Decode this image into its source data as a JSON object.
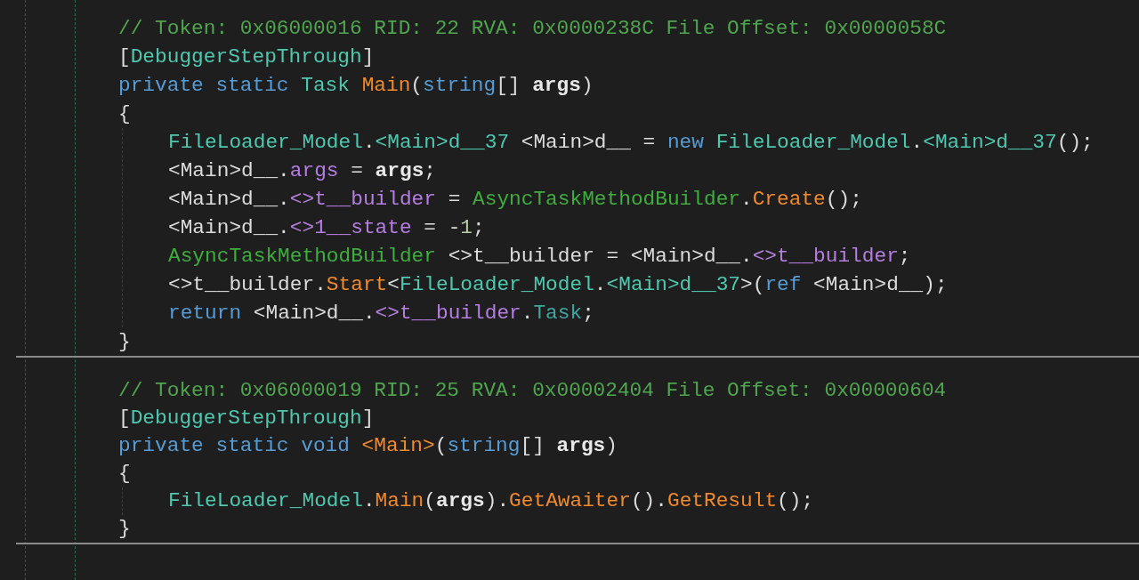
{
  "blocks": [
    {
      "lines": [
        {
          "tokens": [
            {
              "text": "// Token: 0x06000016 RID: 22 RVA: 0x0000238C File Offset: 0x0000058C",
              "kind": "comment"
            }
          ]
        },
        {
          "tokens": [
            {
              "text": "[",
              "kind": "plain"
            },
            {
              "text": "DebuggerStepThrough",
              "kind": "class"
            },
            {
              "text": "]",
              "kind": "plain"
            }
          ]
        },
        {
          "tokens": [
            {
              "text": "private static ",
              "kind": "keyword"
            },
            {
              "text": "Task ",
              "kind": "class"
            },
            {
              "text": "Main",
              "kind": "method"
            },
            {
              "text": "(",
              "kind": "plain"
            },
            {
              "text": "string",
              "kind": "keyword"
            },
            {
              "text": "[] ",
              "kind": "plain"
            },
            {
              "text": "args",
              "kind": "param"
            },
            {
              "text": ")",
              "kind": "plain"
            }
          ]
        },
        {
          "tokens": [
            {
              "text": "{",
              "kind": "plain"
            }
          ],
          "children": [
            {
              "tokens": [
                {
                  "text": "FileLoader_Model",
                  "kind": "class"
                },
                {
                  "text": ".",
                  "kind": "plain"
                },
                {
                  "text": "<Main>d__37",
                  "kind": "class"
                },
                {
                  "text": " <Main>d__ = ",
                  "kind": "plain"
                },
                {
                  "text": "new ",
                  "kind": "keyword"
                },
                {
                  "text": "FileLoader_Model",
                  "kind": "class"
                },
                {
                  "text": ".",
                  "kind": "plain"
                },
                {
                  "text": "<Main>d__37",
                  "kind": "class"
                },
                {
                  "text": "();",
                  "kind": "plain"
                }
              ]
            },
            {
              "tokens": [
                {
                  "text": "<Main>d__.",
                  "kind": "plain"
                },
                {
                  "text": "args",
                  "kind": "field"
                },
                {
                  "text": " = ",
                  "kind": "plain"
                },
                {
                  "text": "args",
                  "kind": "param"
                },
                {
                  "text": ";",
                  "kind": "plain"
                }
              ]
            },
            {
              "tokens": [
                {
                  "text": "<Main>d__.",
                  "kind": "plain"
                },
                {
                  "text": "<>t__builder",
                  "kind": "field"
                },
                {
                  "text": " = ",
                  "kind": "plain"
                },
                {
                  "text": "AsyncTaskMethodBuilder",
                  "kind": "struct"
                },
                {
                  "text": ".",
                  "kind": "plain"
                },
                {
                  "text": "Create",
                  "kind": "method"
                },
                {
                  "text": "();",
                  "kind": "plain"
                }
              ]
            },
            {
              "tokens": [
                {
                  "text": "<Main>d__.",
                  "kind": "plain"
                },
                {
                  "text": "<>1__state",
                  "kind": "field"
                },
                {
                  "text": " = -",
                  "kind": "plain"
                },
                {
                  "text": "1",
                  "kind": "number"
                },
                {
                  "text": ";",
                  "kind": "plain"
                }
              ]
            },
            {
              "tokens": [
                {
                  "text": "AsyncTaskMethodBuilder",
                  "kind": "struct"
                },
                {
                  "text": " <>t__builder = <Main>d__.",
                  "kind": "plain"
                },
                {
                  "text": "<>t__builder",
                  "kind": "field"
                },
                {
                  "text": ";",
                  "kind": "plain"
                }
              ]
            },
            {
              "tokens": [
                {
                  "text": "<>t__builder.",
                  "kind": "plain"
                },
                {
                  "text": "Start",
                  "kind": "method"
                },
                {
                  "text": "<",
                  "kind": "plain"
                },
                {
                  "text": "FileLoader_Model",
                  "kind": "class"
                },
                {
                  "text": ".",
                  "kind": "plain"
                },
                {
                  "text": "<Main>d__37",
                  "kind": "class"
                },
                {
                  "text": ">(",
                  "kind": "plain"
                },
                {
                  "text": "ref",
                  "kind": "keyword"
                },
                {
                  "text": " <Main>d__);",
                  "kind": "plain"
                }
              ]
            },
            {
              "tokens": [
                {
                  "text": "return ",
                  "kind": "keyword"
                },
                {
                  "text": "<Main>d__.",
                  "kind": "plain"
                },
                {
                  "text": "<>t__builder",
                  "kind": "field"
                },
                {
                  "text": ".",
                  "kind": "plain"
                },
                {
                  "text": "Task",
                  "kind": "property"
                },
                {
                  "text": ";",
                  "kind": "plain"
                }
              ]
            }
          ]
        },
        {
          "tokens": [
            {
              "text": "}",
              "kind": "plain"
            }
          ]
        }
      ]
    },
    {
      "lines": [
        {
          "tokens": [
            {
              "text": "// Token: 0x06000019 RID: 25 RVA: 0x00002404 File Offset: 0x00000604",
              "kind": "comment"
            }
          ]
        },
        {
          "tokens": [
            {
              "text": "[",
              "kind": "plain"
            },
            {
              "text": "DebuggerStepThrough",
              "kind": "class"
            },
            {
              "text": "]",
              "kind": "plain"
            }
          ]
        },
        {
          "tokens": [
            {
              "text": "private static void ",
              "kind": "keyword"
            },
            {
              "text": "<Main>",
              "kind": "method"
            },
            {
              "text": "(",
              "kind": "plain"
            },
            {
              "text": "string",
              "kind": "keyword"
            },
            {
              "text": "[] ",
              "kind": "plain"
            },
            {
              "text": "args",
              "kind": "param"
            },
            {
              "text": ")",
              "kind": "plain"
            }
          ]
        },
        {
          "tokens": [
            {
              "text": "{",
              "kind": "plain"
            }
          ],
          "children": [
            {
              "tokens": [
                {
                  "text": "FileLoader_Model",
                  "kind": "class"
                },
                {
                  "text": ".",
                  "kind": "plain"
                },
                {
                  "text": "Main",
                  "kind": "method"
                },
                {
                  "text": "(",
                  "kind": "plain"
                },
                {
                  "text": "args",
                  "kind": "param"
                },
                {
                  "text": ").",
                  "kind": "plain"
                },
                {
                  "text": "GetAwaiter",
                  "kind": "method"
                },
                {
                  "text": "().",
                  "kind": "plain"
                },
                {
                  "text": "GetResult",
                  "kind": "method"
                },
                {
                  "text": "();",
                  "kind": "plain"
                }
              ]
            }
          ]
        },
        {
          "tokens": [
            {
              "text": "}",
              "kind": "plain"
            }
          ]
        }
      ]
    }
  ]
}
